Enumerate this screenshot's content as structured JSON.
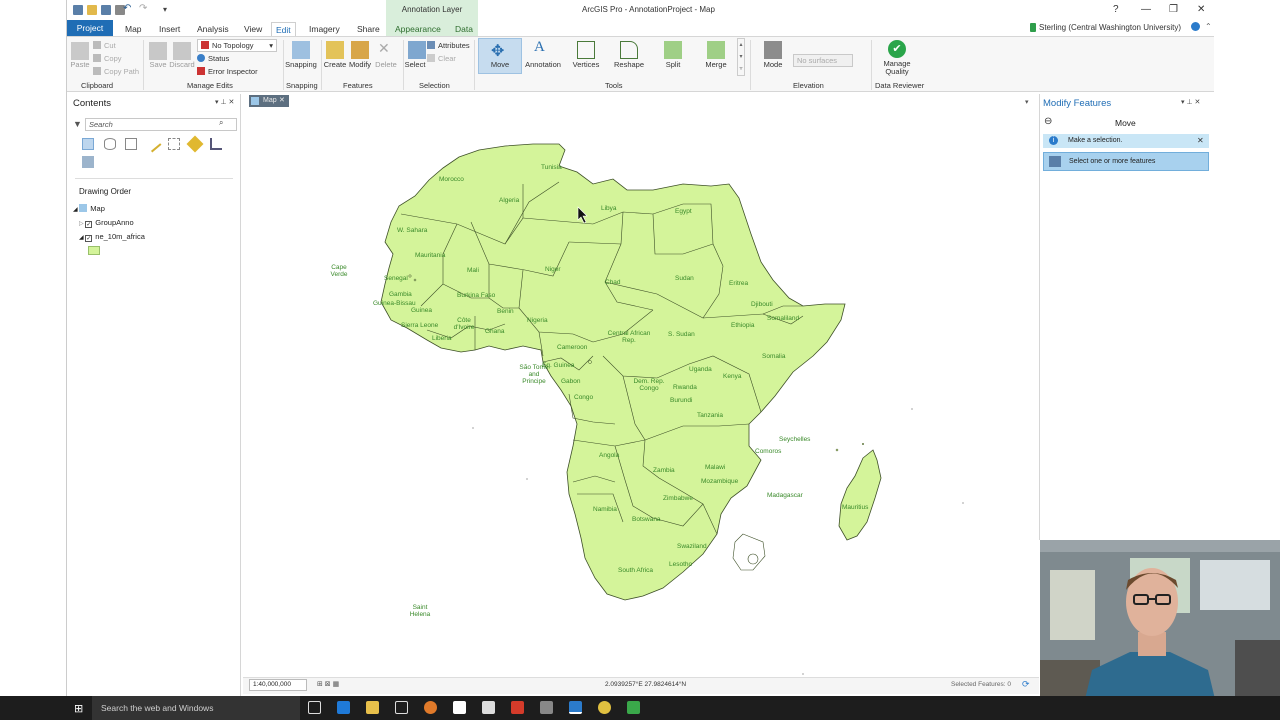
{
  "app": {
    "title": "ArcGIS Pro - AnnotationProject - Map",
    "context_tab_label": "Annotation Layer",
    "user": "Sterling (Central Washington University)"
  },
  "tabs": [
    "Project",
    "Map",
    "Insert",
    "Analysis",
    "View",
    "Edit",
    "Imagery",
    "Share",
    "Appearance",
    "Data"
  ],
  "ribbon": {
    "clipboard": {
      "paste": "Paste",
      "cut": "Cut",
      "copy": "Copy",
      "copy_path": "Copy Path",
      "label": "Clipboard"
    },
    "manage_edits": {
      "save": "Save",
      "discard": "Discard",
      "topology": "No Topology",
      "status": "Status",
      "error_inspector": "Error Inspector",
      "label": "Manage Edits"
    },
    "snapping": {
      "snapping": "Snapping",
      "label": "Snapping"
    },
    "features": {
      "create": "Create",
      "modify": "Modify",
      "delete": "Delete",
      "label": "Features"
    },
    "selection": {
      "select": "Select",
      "attributes": "Attributes",
      "clear": "Clear",
      "label": "Selection"
    },
    "tools": {
      "move": "Move",
      "annotation": "Annotation",
      "vertices": "Vertices",
      "reshape": "Reshape",
      "split": "Split",
      "merge": "Merge",
      "label": "Tools"
    },
    "elevation": {
      "mode": "Mode",
      "surfaces": "No surfaces",
      "label": "Elevation"
    },
    "data_reviewer": {
      "manage_quality_1": "Manage",
      "manage_quality_2": "Quality",
      "label": "Data Reviewer"
    }
  },
  "contents": {
    "title": "Contents",
    "search_placeholder": "Search",
    "drawing_order": "Drawing Order",
    "layers": [
      "Map",
      "GroupAnno",
      "ne_10m_africa"
    ]
  },
  "map": {
    "tab_label": "Map",
    "scale": "1:40,000,000",
    "coords": "2.0939257°E 27.9824614°N",
    "selected_features": "Selected Features: 0",
    "labels": [
      "Morocco",
      "Algeria",
      "Tunisia",
      "Libya",
      "Egypt",
      "W. Sahara",
      "Mauritania",
      "Mali",
      "Niger",
      "Chad",
      "Sudan",
      "Eritrea",
      "Djibouti",
      "Somaliland",
      "Ethiopia",
      "Somalia",
      "Senegal",
      "Gambia",
      "Guinea-Bissau",
      "Guinea",
      "Sierra Leone",
      "Liberia",
      "Côte d'Ivoire",
      "Burkina Faso",
      "Ghana",
      "Benin",
      "Nigeria",
      "Cameroon",
      "Central African Rep.",
      "S. Sudan",
      "Uganda",
      "Kenya",
      "Eq. Guinea",
      "Gabon",
      "Congo",
      "Dem. Rep. Congo",
      "Rwanda",
      "Burundi",
      "Tanzania",
      "Angola",
      "Zambia",
      "Malawi",
      "Mozambique",
      "Namibia",
      "Botswana",
      "Zimbabwe",
      "Swaziland",
      "Lesotho",
      "South Africa",
      "Madagascar",
      "Comoros",
      "Seychelles",
      "Mauritius",
      "Cape Verde",
      "São Tomé and Principe",
      "Saint Helena"
    ]
  },
  "modify": {
    "title": "Modify Features",
    "tool": "Move",
    "msg1": "Make a selection.",
    "msg2": "Select one or more features"
  },
  "taskbar": {
    "search": "Search the web and Windows"
  }
}
